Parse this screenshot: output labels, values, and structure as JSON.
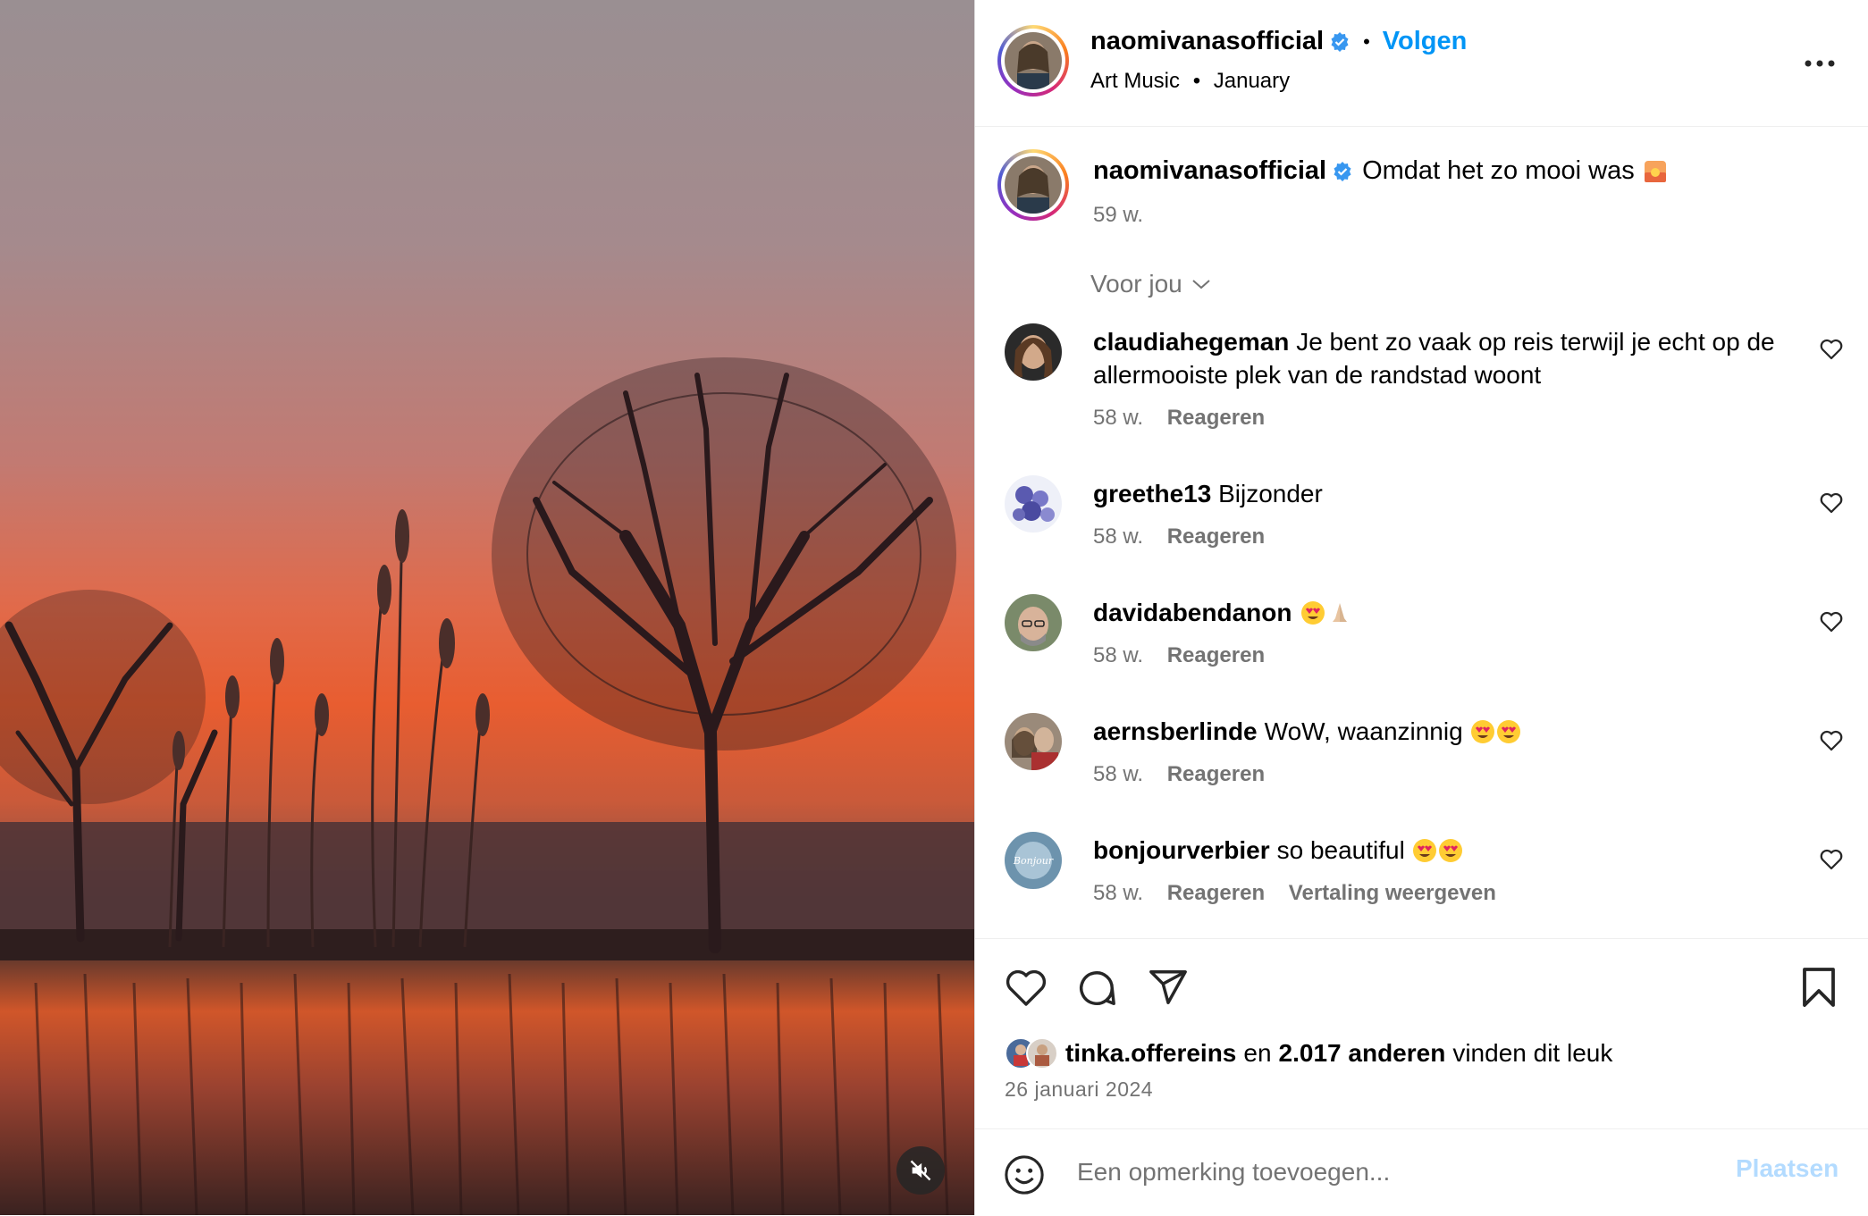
{
  "post": {
    "username": "naomivanasofficial",
    "follow_label": "Volgen",
    "audio": "Art Music",
    "audio_date": "January",
    "caption": "Omdat het zo mooi was",
    "caption_emoji": "sunset-emoji",
    "caption_time": "59 w."
  },
  "for_you_label": "Voor jou",
  "comments": [
    {
      "user": "claudiahegeman",
      "text": "Je bent zo vaak op reis terwijl je echt op de allermooiste plek van de randstad woont",
      "time": "58 w.",
      "reply": "Reageren"
    },
    {
      "user": "greethe13",
      "text": "Bijzonder",
      "time": "58 w.",
      "reply": "Reageren"
    },
    {
      "user": "davidabendanon",
      "text": "",
      "emojis": [
        "heart-eyes",
        "folded-hands"
      ],
      "time": "58 w.",
      "reply": "Reageren"
    },
    {
      "user": "aernsberlinde",
      "text": "WoW, waanzinnig",
      "emojis": [
        "heart-eyes",
        "heart-eyes"
      ],
      "time": "58 w.",
      "reply": "Reageren"
    },
    {
      "user": "bonjourverbier",
      "text": "so beautiful",
      "emojis": [
        "heart-eyes",
        "heart-eyes"
      ],
      "time": "58 w.",
      "reply": "Reageren",
      "translate": "Vertaling weergeven",
      "avatar_text": "Bonjour"
    }
  ],
  "likes": {
    "user": "tinka.offereins",
    "connector": "en",
    "count": "2.017 anderen",
    "suffix": "vinden dit leuk"
  },
  "date": "26 januari 2024",
  "add_comment": {
    "placeholder": "Een opmerking toevoegen...",
    "post_label": "Plaatsen"
  },
  "colors": {
    "accent": "#0095f6",
    "muted": "#737373",
    "verified": "#3897f0",
    "post_disabled": "#b3dbff"
  }
}
